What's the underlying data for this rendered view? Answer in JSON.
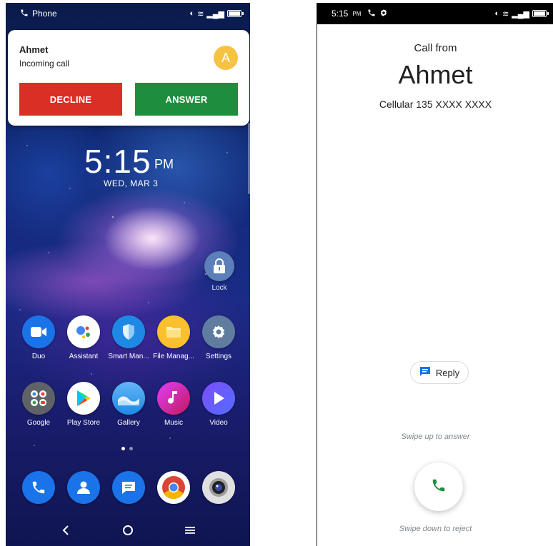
{
  "left_screen": {
    "status": {
      "app_label": "Phone"
    },
    "notification": {
      "caller_name": "Ahmet",
      "text": "Incoming call",
      "avatar_initial": "A",
      "decline_label": "DECLINE",
      "answer_label": "ANSWER"
    },
    "clock": {
      "time": "5:15",
      "ampm": "PM",
      "date": "WED, MAR 3"
    },
    "lock_widget": {
      "label": "Lock"
    },
    "apps_row1": [
      {
        "label": "Duo",
        "icon": "duo-icon"
      },
      {
        "label": "Assistant",
        "icon": "assistant-icon"
      },
      {
        "label": "Smart Man...",
        "icon": "smart-manager-icon"
      },
      {
        "label": "File Manag...",
        "icon": "file-manager-icon"
      },
      {
        "label": "Settings",
        "icon": "settings-icon"
      }
    ],
    "apps_row2": [
      {
        "label": "Google",
        "icon": "google-folder-icon"
      },
      {
        "label": "Play Store",
        "icon": "play-store-icon"
      },
      {
        "label": "Gallery",
        "icon": "gallery-icon"
      },
      {
        "label": "Music",
        "icon": "music-icon"
      },
      {
        "label": "Video",
        "icon": "video-icon"
      }
    ],
    "dock": [
      {
        "icon": "phone-icon"
      },
      {
        "icon": "contacts-icon"
      },
      {
        "icon": "messages-icon"
      },
      {
        "icon": "chrome-icon"
      },
      {
        "icon": "camera-icon"
      }
    ],
    "nav": [
      "back",
      "home",
      "recents"
    ]
  },
  "right_screen": {
    "status": {
      "time": "5:15",
      "ampm": "PM"
    },
    "call_from": "Call from",
    "caller_name": "Ahmet",
    "number": "Cellular 135 XXXX XXXX",
    "reply_label": "Reply",
    "swipe_up": "Swipe up to answer",
    "swipe_down": "Swipe down to reject"
  },
  "colors": {
    "decline": "#d93025",
    "answer": "#1e8e3e",
    "avatar": "#f5c242"
  }
}
